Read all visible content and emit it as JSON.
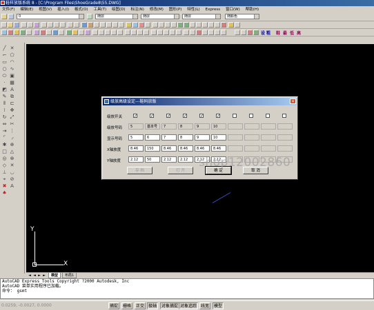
{
  "window": {
    "title": "鞋样放版系统 8 - [C:\\Program Files\\ShoeGrade8\\55.DWG]"
  },
  "menu": {
    "items": [
      "文件(F)",
      "编辑(E)",
      "视图(V)",
      "插入(I)",
      "格式(O)",
      "工具(T)",
      "绘图(D)",
      "标注(N)",
      "修改(M)",
      "图形(P)",
      "特性(L)",
      "Express",
      "窗口(W)",
      "帮助(H)"
    ]
  },
  "toolbars": {
    "layer_combo": "0",
    "color_combo": "随层",
    "linetype_combo": "随层",
    "lineweight_combo": "随层",
    "plotstyle_combo": "随颜色",
    "extra_labels": [
      "设",
      "粗",
      "鞋",
      "最",
      "低",
      "高"
    ]
  },
  "canvas": {
    "ucs_y": "Y",
    "ucs_x": "X"
  },
  "layout_tabs": {
    "nav": [
      "◄",
      "◄",
      "►",
      "►"
    ],
    "tabs": [
      "模型",
      "布局1"
    ]
  },
  "command_line": {
    "lines": [
      "AutoCAD Express Tools Copyright ?2000 Autodesk, Inc",
      "AutoCAD 菜单实用程序已加载。",
      "命令： gsmt"
    ]
  },
  "status_bar": {
    "coords": "0.0259, -0.0027, 0.0000",
    "buttons": [
      "捕捉",
      "栅格",
      "正交",
      "极轴",
      "对象捕捉",
      "对象追踪",
      "线宽",
      "模型"
    ]
  },
  "dialog": {
    "title": "级放高级设定---鞋码放版",
    "close_label": "×",
    "row_labels": [
      "级放开关",
      "级放号码",
      "显示号码",
      "X轴放度",
      "Y轴放度"
    ],
    "switches": [
      true,
      true,
      true,
      true,
      true,
      true,
      false,
      false,
      false,
      false
    ],
    "grade_sizes": [
      "5",
      "基本号",
      "7",
      "8",
      "9",
      "10",
      "",
      "",
      "",
      ""
    ],
    "display_sizes": [
      "5",
      "6",
      "7",
      "8",
      "9",
      "10",
      "",
      "",
      "",
      ""
    ],
    "x_grade": [
      "8.46",
      "150",
      "8.46",
      "8.46",
      "8.46",
      "8.46",
      "",
      "",
      "",
      ""
    ],
    "y_grade": [
      "2.12",
      "50",
      "2.12",
      "2.12",
      "2.12",
      "2.12",
      "",
      "",
      "",
      ""
    ],
    "buttons": {
      "save": "存 档",
      "open": "打 开",
      "ok": "确 定",
      "cancel": "取 消"
    }
  },
  "watermark": "shop12002860",
  "colors": {
    "canvas_bg": "#000000",
    "title_bar": "#0a246a",
    "chrome": "#d4d0c8"
  }
}
